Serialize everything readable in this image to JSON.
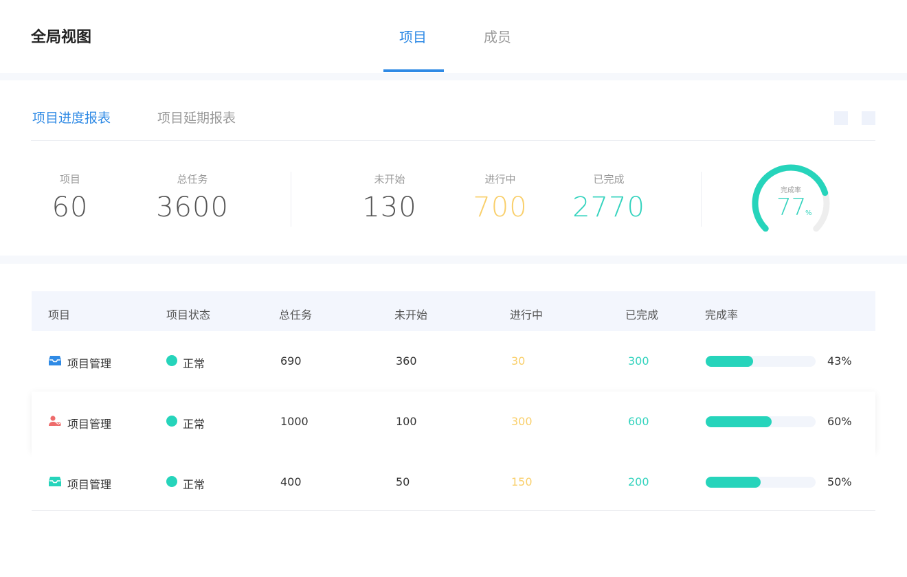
{
  "header": {
    "title": "全局视图",
    "tabs": [
      {
        "label": "项目",
        "active": true
      },
      {
        "label": "成员",
        "active": false
      }
    ]
  },
  "report_tabs": [
    {
      "label": "项目进度报表",
      "active": true
    },
    {
      "label": "项目延期报表",
      "active": false
    }
  ],
  "summary": {
    "projects": {
      "label": "项目",
      "value": "60"
    },
    "total_tasks": {
      "label": "总任务",
      "value": "3600"
    },
    "not_started": {
      "label": "未开始",
      "value": "130"
    },
    "in_progress": {
      "label": "进行中",
      "value": "700"
    },
    "completed": {
      "label": "已完成",
      "value": "2770"
    },
    "completion_rate": {
      "label": "完成率",
      "value": "77",
      "unit": "%",
      "fraction": 0.77
    }
  },
  "table": {
    "columns": [
      "项目",
      "项目状态",
      "总任务",
      "未开始",
      "进行中",
      "已完成",
      "完成率"
    ],
    "rows": [
      {
        "icon": "inbox-icon",
        "icon_color": "#2f8ae5",
        "name": "项目管理",
        "status": "正常",
        "total": "690",
        "not_started": "360",
        "in_progress": "30",
        "completed": "300",
        "rate_text": "43%",
        "rate": 0.43
      },
      {
        "icon": "user-mail-icon",
        "icon_color": "#ee6b6b",
        "name": "项目管理",
        "status": "正常",
        "total": "1000",
        "not_started": "100",
        "in_progress": "300",
        "completed": "600",
        "rate_text": "60%",
        "rate": 0.6
      },
      {
        "icon": "inbox-icon",
        "icon_color": "#26d4bb",
        "name": "项目管理",
        "status": "正常",
        "total": "400",
        "not_started": "50",
        "in_progress": "150",
        "completed": "200",
        "rate_text": "50%",
        "rate": 0.5
      }
    ]
  },
  "colors": {
    "accent": "#2f8ae5",
    "teal": "#34d3be",
    "yellow": "#f9cf6a",
    "status_normal": "#26d4bb"
  }
}
